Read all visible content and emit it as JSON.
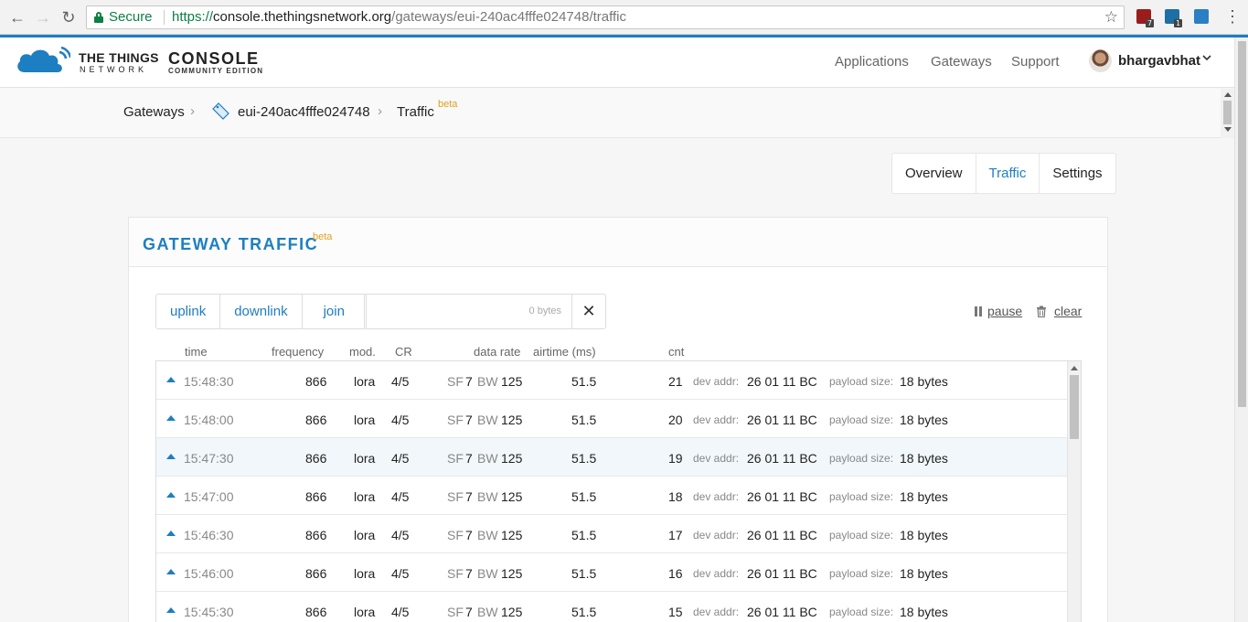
{
  "browser": {
    "secure_label": "Secure",
    "url_scheme": "https://",
    "url_host": "console.thethingsnetwork.org",
    "url_path": "/gateways/eui-240ac4fffe024748/traffic",
    "ext_badges": [
      "7",
      "1"
    ]
  },
  "header": {
    "logo_line1": "THE THINGS",
    "logo_line2": "NETWORK",
    "console_title": "CONSOLE",
    "console_subtitle": "COMMUNITY EDITION",
    "nav": [
      "Applications",
      "Gateways",
      "Support"
    ],
    "username": "bhargavbhat"
  },
  "breadcrumb": {
    "root": "Gateways",
    "gateway_id": "eui-240ac4fffe024748",
    "current": "Traffic",
    "current_badge": "beta"
  },
  "tabs": [
    {
      "label": "Overview",
      "active": false
    },
    {
      "label": "Traffic",
      "active": true
    },
    {
      "label": "Settings",
      "active": false
    }
  ],
  "card": {
    "title": "GATEWAY TRAFFIC",
    "badge": "beta",
    "filters": [
      "uplink",
      "downlink",
      "join"
    ],
    "search_bytes": "0 bytes",
    "pause_label": "pause",
    "clear_label": "clear"
  },
  "table": {
    "headers": [
      "time",
      "frequency",
      "mod.",
      "CR",
      "data rate",
      "airtime (ms)",
      "cnt"
    ],
    "label_sf": "SF",
    "label_bw": "BW",
    "label_devaddr": "dev addr:",
    "label_payload": "payload size:",
    "rows": [
      {
        "time": "15:48:30",
        "frequency": "866",
        "mod": "lora",
        "cr": "4/5",
        "sf": "7",
        "bw": "125",
        "airtime": "51.5",
        "cnt": "21",
        "dev_addr": "26 01 11 BC",
        "payload": "18 bytes"
      },
      {
        "time": "15:48:00",
        "frequency": "866",
        "mod": "lora",
        "cr": "4/5",
        "sf": "7",
        "bw": "125",
        "airtime": "51.5",
        "cnt": "20",
        "dev_addr": "26 01 11 BC",
        "payload": "18 bytes"
      },
      {
        "time": "15:47:30",
        "frequency": "866",
        "mod": "lora",
        "cr": "4/5",
        "sf": "7",
        "bw": "125",
        "airtime": "51.5",
        "cnt": "19",
        "dev_addr": "26 01 11 BC",
        "payload": "18 bytes"
      },
      {
        "time": "15:47:00",
        "frequency": "866",
        "mod": "lora",
        "cr": "4/5",
        "sf": "7",
        "bw": "125",
        "airtime": "51.5",
        "cnt": "18",
        "dev_addr": "26 01 11 BC",
        "payload": "18 bytes"
      },
      {
        "time": "15:46:30",
        "frequency": "866",
        "mod": "lora",
        "cr": "4/5",
        "sf": "7",
        "bw": "125",
        "airtime": "51.5",
        "cnt": "17",
        "dev_addr": "26 01 11 BC",
        "payload": "18 bytes"
      },
      {
        "time": "15:46:00",
        "frequency": "866",
        "mod": "lora",
        "cr": "4/5",
        "sf": "7",
        "bw": "125",
        "airtime": "51.5",
        "cnt": "16",
        "dev_addr": "26 01 11 BC",
        "payload": "18 bytes"
      },
      {
        "time": "15:45:30",
        "frequency": "866",
        "mod": "lora",
        "cr": "4/5",
        "sf": "7",
        "bw": "125",
        "airtime": "51.5",
        "cnt": "15",
        "dev_addr": "26 01 11 BC",
        "payload": "18 bytes"
      }
    ]
  },
  "colors": {
    "accent": "#1d7ec1",
    "beta": "#e0a020",
    "secure": "#0b8043"
  }
}
